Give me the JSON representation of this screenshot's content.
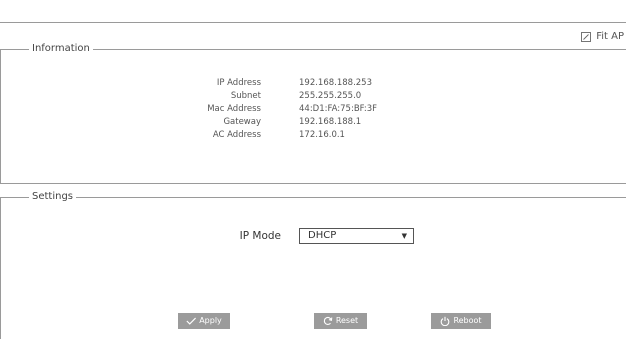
{
  "header": {
    "fit_ap_label": "Fit AP",
    "fit_ap_icon": "edit-icon"
  },
  "information": {
    "legend": "Information",
    "rows": [
      {
        "label": "IP Address",
        "value": "192.168.188.253"
      },
      {
        "label": "Subnet",
        "value": "255.255.255.0"
      },
      {
        "label": "Mac Address",
        "value": "44:D1:FA:75:BF:3F"
      },
      {
        "label": "Gateway",
        "value": "192.168.188.1"
      },
      {
        "label": "AC Address",
        "value": "172.16.0.1"
      }
    ]
  },
  "settings": {
    "legend": "Settings",
    "ip_mode_label": "IP Mode",
    "ip_mode_value": "DHCP",
    "buttons": {
      "apply": "Apply",
      "reset": "Reset",
      "reboot": "Reboot"
    },
    "button_icons": {
      "apply": "checkmark-icon",
      "reset": "refresh-icon",
      "reboot": "power-icon"
    }
  },
  "colors": {
    "button_bg": "#9b9b9b",
    "border": "#9a9a9a"
  }
}
